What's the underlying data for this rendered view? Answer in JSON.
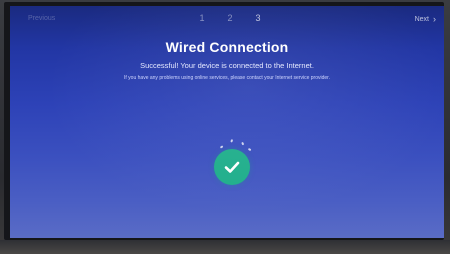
{
  "header": {
    "back_label": "Previous",
    "steps": [
      "1",
      "2",
      "3"
    ],
    "active_step": 3,
    "next_label": "Next",
    "next_icon": "chevron-right-icon"
  },
  "main": {
    "title": "Wired Connection",
    "message": "Successful! Your device is connected to the Internet.",
    "help_text": "If you have any problems using online services, please contact your Internet service provider.",
    "status_icon": "check-circle-icon"
  },
  "colors": {
    "background": "#2d42b7",
    "success": "#1fae8b",
    "text": "#ffffff"
  }
}
